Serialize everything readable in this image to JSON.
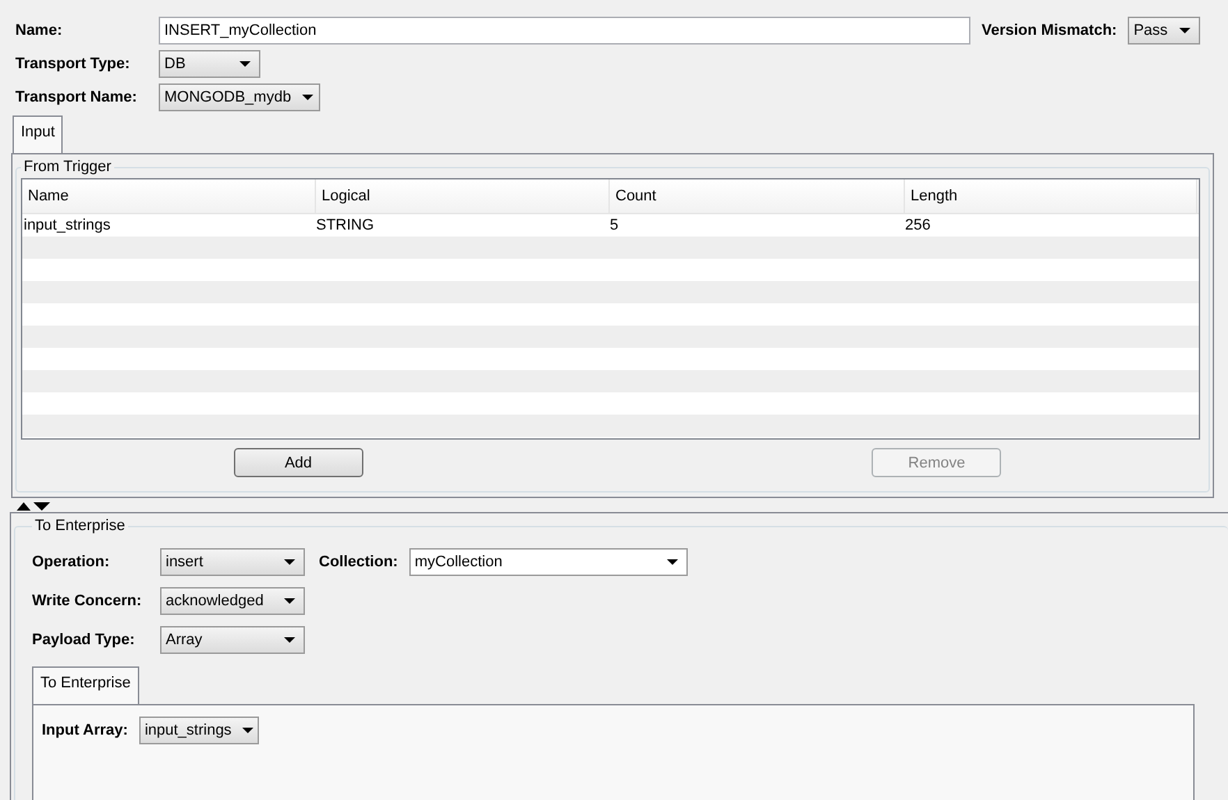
{
  "header": {
    "name_label": "Name:",
    "name_value": "INSERT_myCollection",
    "version_label": "Version Mismatch:",
    "version_value": "Pass",
    "transport_type_label": "Transport Type:",
    "transport_type_value": "DB",
    "transport_name_label": "Transport Name:",
    "transport_name_value": "MONGODB_mydb"
  },
  "tabs": [
    {
      "label": "Input",
      "selected": true
    }
  ],
  "from_trigger": {
    "title": "From Trigger",
    "table": {
      "columns": [
        "Name",
        "Logical",
        "Count",
        "Length"
      ],
      "rows": [
        [
          "input_strings",
          "STRING",
          "5",
          "256"
        ]
      ]
    },
    "buttons": [
      {
        "label": "Add",
        "disabled": false
      },
      {
        "label": "Remove",
        "disabled": true
      }
    ]
  },
  "to_enterprise": {
    "title": "To Enterprise",
    "operation_label": "Operation:",
    "operation_value": "insert",
    "collection_label": "Collection:",
    "collection_value": "myCollection",
    "write_concern_label": "Write Concern:",
    "write_concern_value": "acknowledged",
    "payload_type_label": "Payload Type:",
    "payload_type_value": "Array",
    "tabs": [
      {
        "label": "To Enterprise",
        "selected": true
      }
    ],
    "input_array_label": "Input Array:",
    "input_array_value": "input_strings"
  }
}
